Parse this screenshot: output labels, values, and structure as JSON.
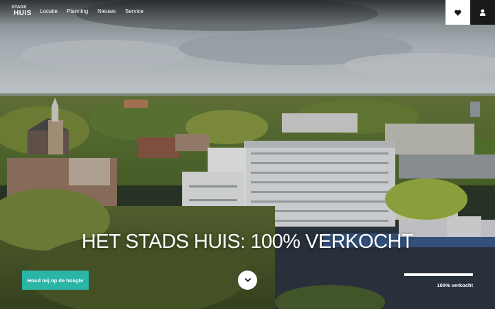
{
  "header": {
    "logo": {
      "line1": "STADS",
      "line2": "HUIS"
    },
    "nav": [
      {
        "label": "Locatie"
      },
      {
        "label": "Planning"
      },
      {
        "label": "Nieuws"
      },
      {
        "label": "Service"
      }
    ],
    "icons": {
      "favorites": "heart-icon",
      "account": "user-icon"
    }
  },
  "hero": {
    "headline": "HET STADS HUIS: 100% VERKOCHT",
    "cta_label": "Houd mij op de hoogte",
    "scroll_icon": "chevron-down-icon",
    "progress": {
      "label": "100% verkocht",
      "value": 1.0
    }
  },
  "colors": {
    "accent": "#2bb5a6",
    "dark": "#1a1a1a"
  }
}
